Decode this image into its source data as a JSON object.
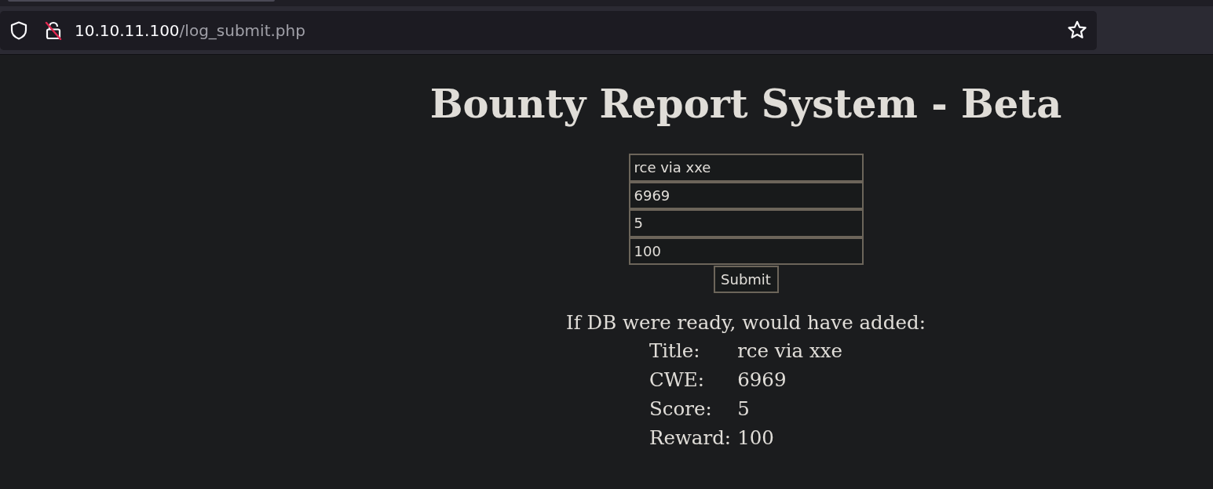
{
  "browser": {
    "url": {
      "host": "10.10.11.100",
      "path": "/log_submit.php"
    }
  },
  "page": {
    "title": "Bounty Report System - Beta",
    "form": {
      "fields": [
        {
          "value": "rce via xxe"
        },
        {
          "value": "6969"
        },
        {
          "value": "5"
        },
        {
          "value": "100"
        }
      ],
      "submit": "Submit"
    },
    "result": {
      "intro": "If DB were ready, would have added:",
      "rows": [
        {
          "label": "Title:",
          "value": "rce via xxe"
        },
        {
          "label": "CWE:",
          "value": "6969"
        },
        {
          "label": "Score:",
          "value": "5"
        },
        {
          "label": "Reward:",
          "value": "100"
        }
      ]
    }
  }
}
